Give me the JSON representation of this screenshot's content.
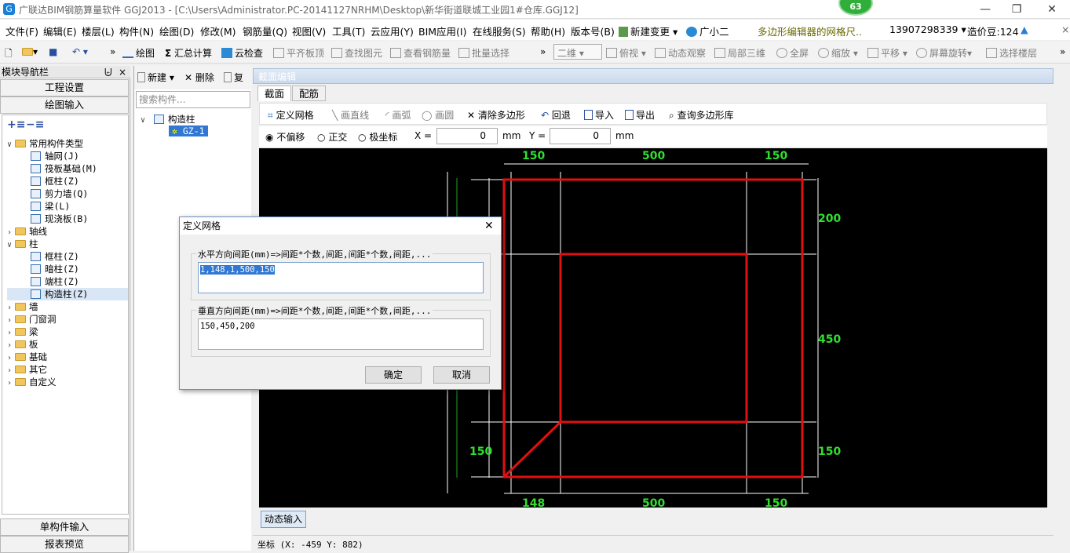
{
  "titlebar": {
    "title": "广联达BIM钢筋算量软件 GGJ2013 - [C:\\Users\\Administrator.PC-20141127NRHM\\Desktop\\新华街道联城工业园1#仓库.GGJ12]",
    "badge": "63"
  },
  "menu": {
    "items": [
      "文件(F)",
      "编辑(E)",
      "楼层(L)",
      "构件(N)",
      "绘图(D)",
      "修改(M)",
      "钢筋量(Q)",
      "视图(V)",
      "工具(T)",
      "云应用(Y)",
      "BIM应用(I)",
      "在线服务(S)",
      "帮助(H)",
      "版本号(B)"
    ],
    "new_change": "新建变更",
    "assistant": "广小二",
    "notice": "多边形编辑器的网格尺..",
    "phone": "13907298339",
    "balance": "造价豆:124"
  },
  "toolbar": {
    "draw": "绘图",
    "summary": "汇总计算",
    "cloud_check": "云检查",
    "flush_top": "平齐板顶",
    "find": "查找图元",
    "view_steel": "查看钢筋量",
    "batch_select": "批量选择",
    "view_mode": "二维",
    "top_view": "俯视",
    "dynamic": "动态观察",
    "local3d": "局部三维",
    "fullscreen": "全屏",
    "zoom": "缩放",
    "pan": "平移",
    "rotate": "屏幕旋转",
    "select_floor": "选择楼层"
  },
  "nav": {
    "title": "模块导航栏",
    "project_settings": "工程设置",
    "drawing_input": "绘图输入",
    "single_input": "单构件输入",
    "report_preview": "报表预览",
    "tree": [
      {
        "label": "常用构件类型",
        "level": 0,
        "expanded": true,
        "folder": true
      },
      {
        "label": "轴网(J)",
        "level": 1
      },
      {
        "label": "筏板基础(M)",
        "level": 1
      },
      {
        "label": "框柱(Z)",
        "level": 1
      },
      {
        "label": "剪力墙(Q)",
        "level": 1
      },
      {
        "label": "梁(L)",
        "level": 1
      },
      {
        "label": "现浇板(B)",
        "level": 1
      },
      {
        "label": "轴线",
        "level": 0,
        "expanded": false,
        "folder": true
      },
      {
        "label": "柱",
        "level": 0,
        "expanded": true,
        "folder": true
      },
      {
        "label": "框柱(Z)",
        "level": 1
      },
      {
        "label": "暗柱(Z)",
        "level": 1
      },
      {
        "label": "端柱(Z)",
        "level": 1
      },
      {
        "label": "构造柱(Z)",
        "level": 1,
        "selected": true
      },
      {
        "label": "墙",
        "level": 0,
        "expanded": false,
        "folder": true
      },
      {
        "label": "门窗洞",
        "level": 0,
        "expanded": false,
        "folder": true
      },
      {
        "label": "梁",
        "level": 0,
        "expanded": false,
        "folder": true
      },
      {
        "label": "板",
        "level": 0,
        "expanded": false,
        "folder": true
      },
      {
        "label": "基础",
        "level": 0,
        "expanded": false,
        "folder": true
      },
      {
        "label": "其它",
        "level": 0,
        "expanded": false,
        "folder": true
      },
      {
        "label": "自定义",
        "level": 0,
        "expanded": false,
        "folder": true
      }
    ]
  },
  "components": {
    "new": "新建",
    "delete": "删除",
    "copy": "复",
    "search_placeholder": "搜索构件...",
    "root": "构造柱",
    "child": "GZ-1"
  },
  "editor": {
    "title": "截面编辑",
    "tabs": [
      "截面",
      "配筋"
    ],
    "tools": {
      "define_grid": "定义网格",
      "draw_line": "画直线",
      "draw_arc": "画弧",
      "draw_circle": "画圆",
      "clear_polygon": "清除多边形",
      "undo": "回退",
      "import": "导入",
      "export": "导出",
      "query_lib": "查询多边形库"
    },
    "offset": {
      "no_offset": "不偏移",
      "orthogonal": "正交",
      "polar": "极坐标",
      "x_label": "X =",
      "x_value": "0",
      "y_label": "Y =",
      "y_value": "0",
      "unit": "mm"
    },
    "dims": {
      "top": [
        "150",
        "500",
        "150"
      ],
      "bottom": [
        "148",
        "500",
        "150"
      ],
      "right": [
        "200",
        "450",
        "150"
      ],
      "left_bottom": "150"
    },
    "dynamic_input": "动态输入"
  },
  "status": {
    "coord": "坐标 (X: -459 Y: 882)"
  },
  "dialog": {
    "title": "定义网格",
    "h_label": "水平方向间距(mm)=>间距*个数,间距,间距*个数,间距,...",
    "h_value": "1,148,1,500,150",
    "v_label": "垂直方向间距(mm)=>间距*个数,间距,间距*个数,间距,...",
    "v_value": "150,450,200",
    "ok": "确定",
    "cancel": "取消"
  }
}
